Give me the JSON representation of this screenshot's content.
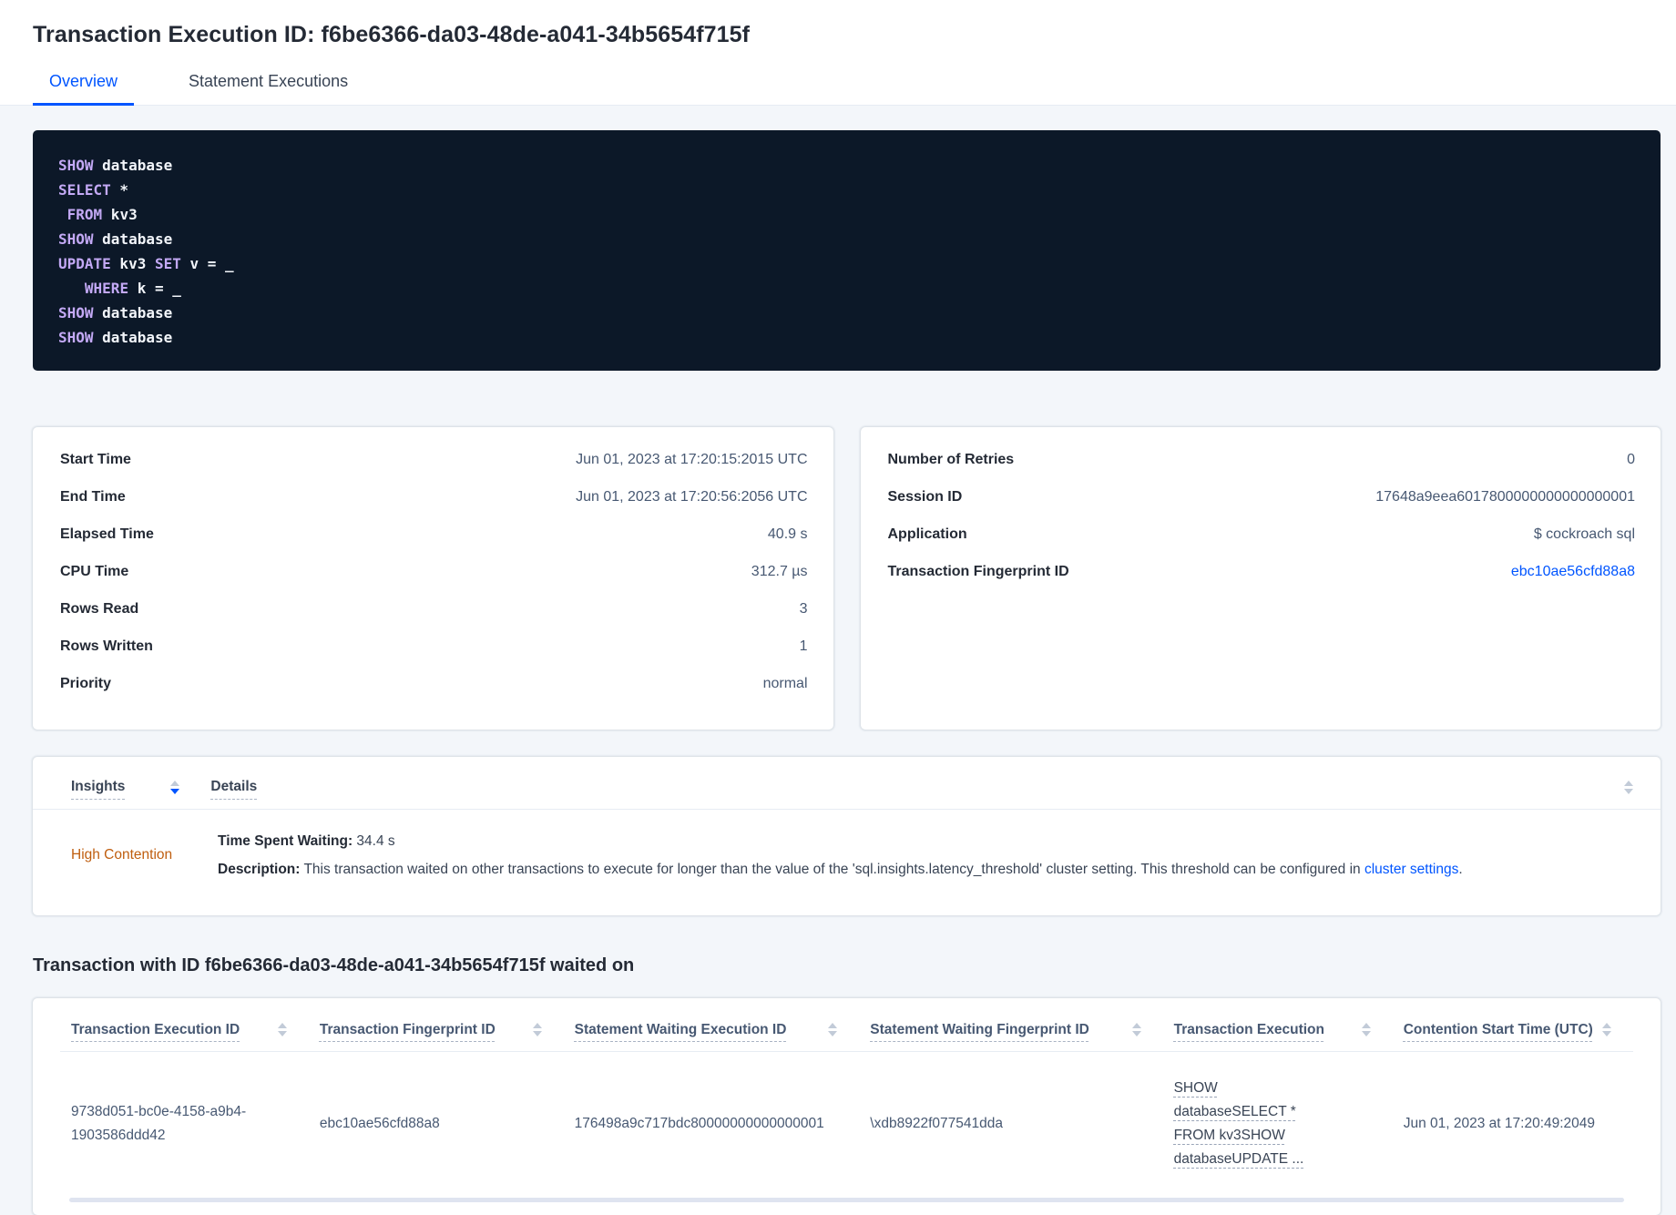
{
  "colors": {
    "accent": "#0055ff",
    "contention": "#bf5d0e",
    "kw": "#c3a9f5"
  },
  "page": {
    "title": "Transaction Execution ID: f6be6366-da03-48de-a041-34b5654f715f"
  },
  "tabs": {
    "overview": "Overview",
    "statement_executions": "Statement Executions"
  },
  "sql": {
    "lines": [
      {
        "s0": "SHOW",
        "s1": " database"
      },
      {
        "s0": "SELECT",
        "s1": " *"
      },
      {
        "s0": " ",
        "s1": "FROM",
        "s2": " kv3"
      },
      {
        "s0": "SHOW",
        "s1": " database"
      },
      {
        "s0": "UPDATE",
        "s1": " kv3 ",
        "s2": "SET",
        "s3": " v = _"
      },
      {
        "s0": "   ",
        "s1": "WHERE",
        "s2": " k = _"
      },
      {
        "s0": "SHOW",
        "s1": " database"
      },
      {
        "s0": "SHOW",
        "s1": " database"
      }
    ]
  },
  "details_left": {
    "rows": [
      {
        "label": "Start Time",
        "value": "Jun 01, 2023 at 17:20:15:2015 UTC"
      },
      {
        "label": "End Time",
        "value": "Jun 01, 2023 at 17:20:56:2056 UTC"
      },
      {
        "label": "Elapsed Time",
        "value": "40.9 s"
      },
      {
        "label": "CPU Time",
        "value": "312.7 µs"
      },
      {
        "label": "Rows Read",
        "value": "3"
      },
      {
        "label": "Rows Written",
        "value": "1"
      },
      {
        "label": "Priority",
        "value": "normal"
      }
    ]
  },
  "details_right": {
    "rows": [
      {
        "label": "Number of Retries",
        "value": "0"
      },
      {
        "label": "Session ID",
        "value": "17648a9eea6017800000000000000001"
      },
      {
        "label": "Application",
        "value": "$ cockroach sql"
      },
      {
        "label": "Transaction Fingerprint ID",
        "value": "ebc10ae56cfd88a8"
      }
    ]
  },
  "insights": {
    "col_insights": "Insights",
    "col_details": "Details",
    "row": {
      "name": "High Contention",
      "waiting_label": "Time Spent Waiting:",
      "waiting_value": " 34.4 s",
      "description_label": "Description:",
      "description_text": " This transaction waited on other transactions to execute for longer than the value of the 'sql.insights.latency_threshold' cluster setting. This threshold can be configured in ",
      "description_link": "cluster settings",
      "description_end": "."
    }
  },
  "waited_on": {
    "heading": "Transaction with ID f6be6366-da03-48de-a041-34b5654f715f waited on",
    "columns": [
      "Transaction Execution ID",
      "Transaction Fingerprint ID",
      "Statement Waiting Execution ID",
      "Statement Waiting Fingerprint ID",
      "Transaction Execution",
      "Contention Start Time (UTC)"
    ],
    "row": {
      "transaction_execution_id": "9738d051-bc0e-4158-a9b4-1903586ddd42",
      "transaction_fingerprint_id": "ebc10ae56cfd88a8",
      "statement_waiting_execution_id": "176498a9c717bdc80000000000000001",
      "statement_waiting_fingerprint_id": "\\xdb8922f077541dda",
      "transaction_execution": "SHOW databaseSELECT * FROM kv3SHOW databaseUPDATE ...",
      "contention_start_time": "Jun 01, 2023 at 17:20:49:2049"
    }
  }
}
